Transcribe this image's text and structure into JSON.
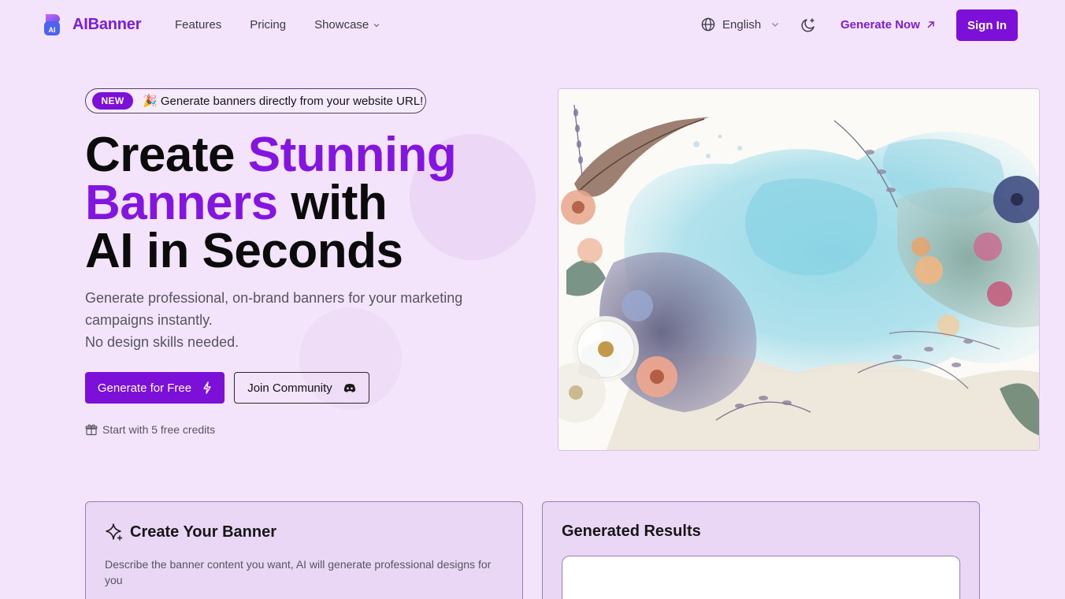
{
  "header": {
    "brand_name": "AIBanner",
    "logo_text": "AI",
    "nav": {
      "features": "Features",
      "pricing": "Pricing",
      "showcase": "Showcase"
    },
    "language": "English",
    "generate_now": "Generate Now",
    "sign_in": "Sign In"
  },
  "hero": {
    "badge": "NEW",
    "announcement": "🎉 Generate banners directly from your website URL!",
    "title": {
      "part1": "Create ",
      "accent1": "Stunning",
      "accent2": "Banners",
      "part2": " with",
      "line3": "AI in Seconds"
    },
    "subtitle_line1": "Generate professional, on-brand banners for your marketing campaigns instantly.",
    "subtitle_line2": "No design skills needed.",
    "primary_button": "Generate for Free",
    "secondary_button": "Join Community",
    "credits_note": "Start with 5 free credits"
  },
  "create_card": {
    "title": "Create Your Banner",
    "description": "Describe the banner content you want, AI will generate professional designs for you"
  },
  "results_card": {
    "title": "Generated Results"
  },
  "colors": {
    "accent": "#7c10d9",
    "background": "#f3e4fb",
    "brand_text": "#7c1ed9"
  },
  "icons": {
    "logo": "aibanner-logo-icon",
    "globe": "globe-icon",
    "theme": "moon-sparkle-icon",
    "external": "arrow-up-right-icon",
    "bolt": "lightning-icon",
    "discord": "discord-icon",
    "gift": "gift-icon",
    "sparkle": "sparkle-icon"
  }
}
